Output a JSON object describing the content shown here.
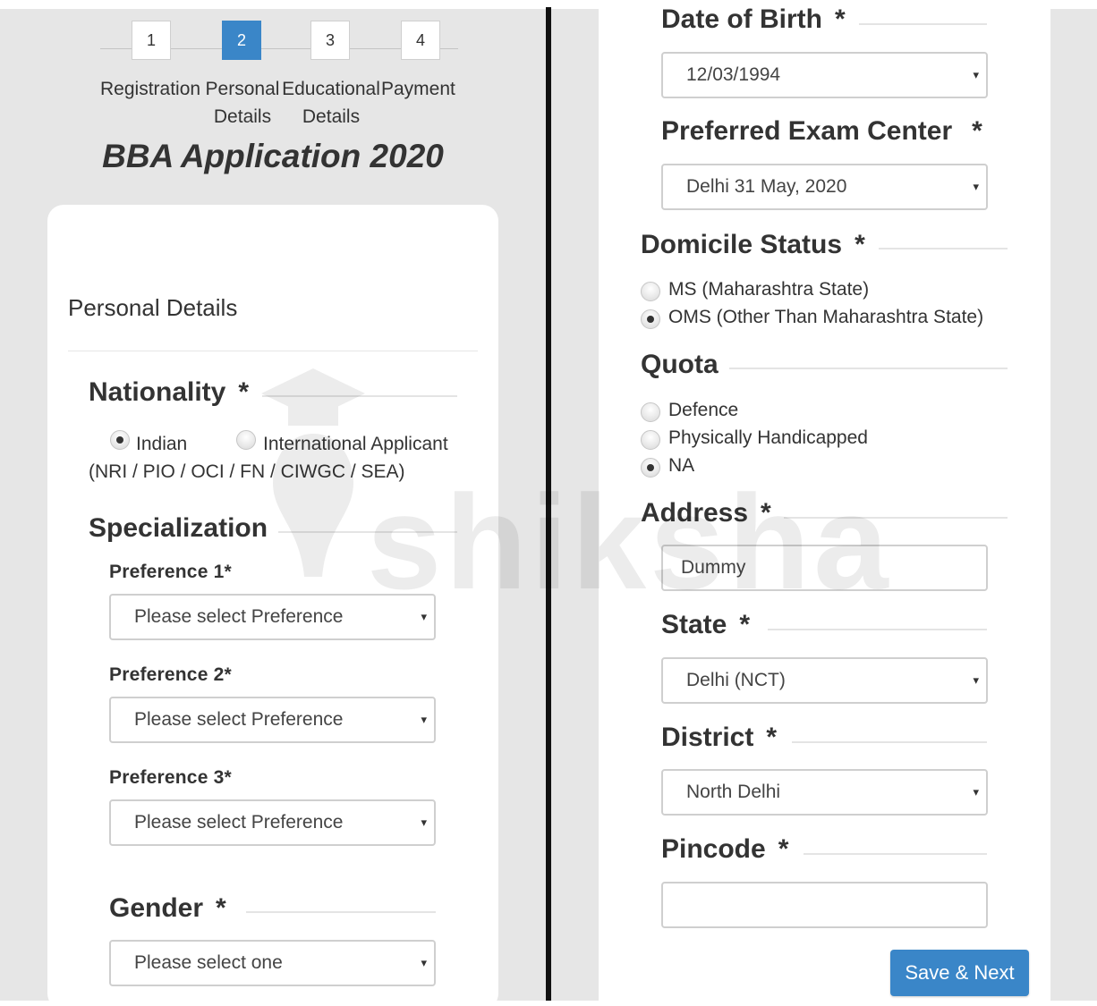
{
  "steps": [
    {
      "number": "1",
      "label_line1": "Registration",
      "label_line2": "",
      "active": false
    },
    {
      "number": "2",
      "label_line1": "Personal",
      "label_line2": "Details",
      "active": true
    },
    {
      "number": "3",
      "label_line1": "Educational",
      "label_line2": "Details",
      "active": false
    },
    {
      "number": "4",
      "label_line1": "Payment",
      "label_line2": "",
      "active": false
    }
  ],
  "app_title": "BBA Application 2020",
  "personal": {
    "section_title": "Personal Details",
    "nationality": {
      "title": "Nationality",
      "required": "*",
      "options": [
        "Indian",
        "International Applicant"
      ],
      "note": "(NRI / PIO / OCI / FN / CIWGC / SEA)",
      "selected": "Indian"
    },
    "specialization": {
      "title": "Specialization",
      "preferences": [
        {
          "label": "Preference 1*",
          "value": "Please select Preference"
        },
        {
          "label": "Preference 2*",
          "value": "Please select Preference"
        },
        {
          "label": "Preference 3*",
          "value": "Please select Preference"
        }
      ]
    },
    "gender": {
      "title": "Gender",
      "required": "*",
      "value": "Please select one"
    }
  },
  "right": {
    "dob": {
      "title": "Date of Birth",
      "required": "*",
      "value": "12/03/1994"
    },
    "exam_center": {
      "title": "Preferred Exam Center",
      "required": "*",
      "value": "Delhi 31 May, 2020"
    },
    "domicile": {
      "title": "Domicile Status",
      "required": "*",
      "options": [
        "MS (Maharashtra State)",
        "OMS (Other Than Maharashtra State)"
      ],
      "selected": "OMS (Other Than Maharashtra State)"
    },
    "quota": {
      "title": "Quota",
      "options": [
        "Defence",
        "Physically Handicapped",
        "NA"
      ],
      "selected": "NA"
    },
    "address": {
      "title": "Address",
      "required": "*",
      "value": "Dummy"
    },
    "state": {
      "title": "State",
      "required": "*",
      "value": "Delhi (NCT)"
    },
    "district": {
      "title": "District",
      "required": "*",
      "value": "North Delhi"
    },
    "pincode": {
      "title": "Pincode",
      "required": "*",
      "value": ""
    },
    "save_button": "Save & Next"
  },
  "watermark_text": "shiksha",
  "colors": {
    "accent": "#3a86c8",
    "panel_bg": "#e6e6e6",
    "divider": "#111111"
  },
  "icons": {
    "select_caret": "▾"
  }
}
